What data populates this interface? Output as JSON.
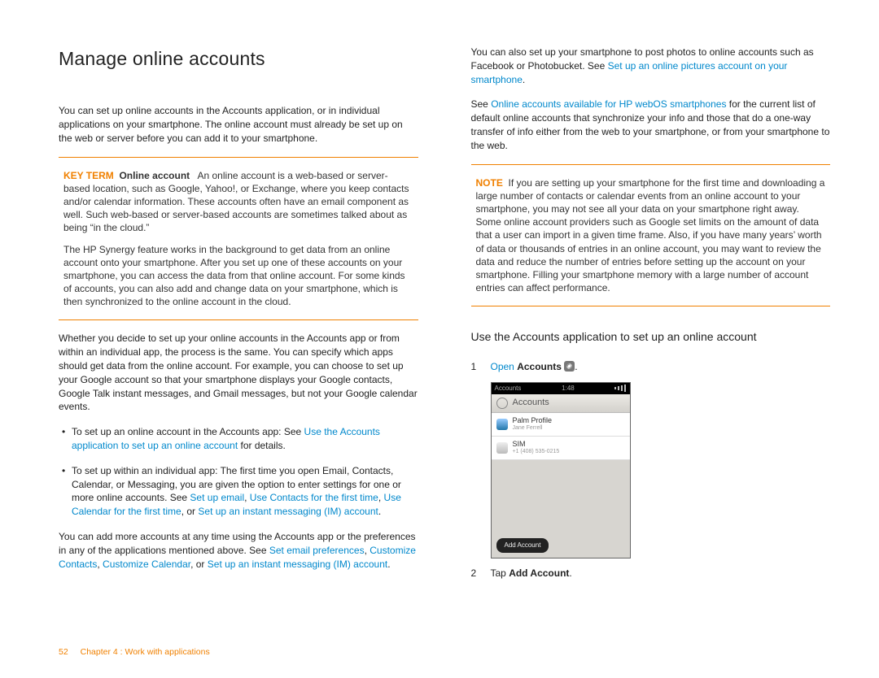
{
  "heading": "Manage online accounts",
  "intro": "You can set up online accounts in the Accounts application, or in individual applications on your smartphone. The online account must already be set up on the web or server before you can add it to your smartphone.",
  "keyterm": {
    "label": "KEY TERM",
    "term": "Online account",
    "text1": "An online account is a web-based or server-based location, such as Google, Yahoo!, or Exchange, where you keep contacts and/or calendar information. These accounts often have an email component as well. Such web-based or server-based accounts are sometimes talked about as being “in the cloud.”",
    "text2": "The HP Synergy feature works in the background to get data from an online account onto your smartphone. After you set up one of these accounts on your smartphone, you can access the data from that online account. For some kinds of accounts, you can also add and change data on your smartphone, which is then synchronized to the online account in the cloud."
  },
  "para2": "Whether you decide to set up your online accounts in the Accounts app or from within an individual app, the process is the same. You can specify which apps should get data from the online account. For example, you can choose to set up your Google account so that your smartphone displays your Google contacts, Google Talk instant messages, and Gmail messages, but not your Google calendar events.",
  "bullets": {
    "b1_a": "To set up an online account in the Accounts app: See ",
    "b1_link": "Use the Accounts application to set up an online account",
    "b1_c": " for details.",
    "b2_a": "To set up within an individual app: The first time you open Email, Contacts, Calendar, or Messaging, you are given the option to enter settings for one or more online accounts. See ",
    "b2_l1": "Set up email",
    "b2_s1": ", ",
    "b2_l2": "Use Contacts for the first time",
    "b2_s2": ", ",
    "b2_l3": "Use Calendar for the first time",
    "b2_s3": ", or ",
    "b2_l4": "Set up an instant messaging (IM) account",
    "b2_end": "."
  },
  "para3_a": "You can add more accounts at any time using the Accounts app or the preferences in any of the applications mentioned above. See ",
  "para3_l1": "Set email preferences",
  "para3_s1": ", ",
  "para3_l2": "Customize Contacts",
  "para3_s2": ", ",
  "para3_l3": "Customize Calendar",
  "para3_s3": ", or ",
  "para3_l4": "Set up an instant messaging (IM) account",
  "para3_end": ".",
  "right_p1_a": "You can also set up your smartphone to post photos to online accounts such as Facebook or Photobucket. See ",
  "right_p1_link": "Set up an online pictures account on your smartphone",
  "right_p1_end": ".",
  "right_p2_a": "See ",
  "right_p2_link": "Online accounts available for HP webOS smartphones",
  "right_p2_b": " for the current list of default online accounts that synchronize your info and those that do a one-way transfer of info either from the web to your smartphone, or from your smartphone to the web.",
  "note": {
    "label": "NOTE",
    "text": "If you are setting up your smartphone for the first time and downloading a large number of contacts or calendar events from an online account to your smartphone, you may not see all your data on your smartphone right away. Some online account providers such as Google set limits on the amount of data that a user can import in a given time frame. Also, if you have many years’ worth of data or thousands of entries in an online account, you may want to review the data and reduce the number of entries before setting up the account on your smartphone. Filling your smartphone memory with a large number of account entries can affect performance."
  },
  "subheading": "Use the Accounts application to set up an online account",
  "steps": {
    "s1_num": "1",
    "s1_link": "Open",
    "s1_bold": "Accounts",
    "s1_end": ".",
    "s2_num": "2",
    "s2_a": "Tap ",
    "s2_bold": "Add Account",
    "s2_end": "."
  },
  "ss": {
    "top_left": "Accounts",
    "top_time": "1:48",
    "header": "Accounts",
    "row1_title": "Palm Profile",
    "row1_sub": "Jane Ferrell",
    "row2_title": "SIM",
    "row2_sub": "+1 (408) 535-0215",
    "add_btn": "Add Account"
  },
  "footer": {
    "page": "52",
    "chapter": "Chapter 4 : Work with applications"
  }
}
